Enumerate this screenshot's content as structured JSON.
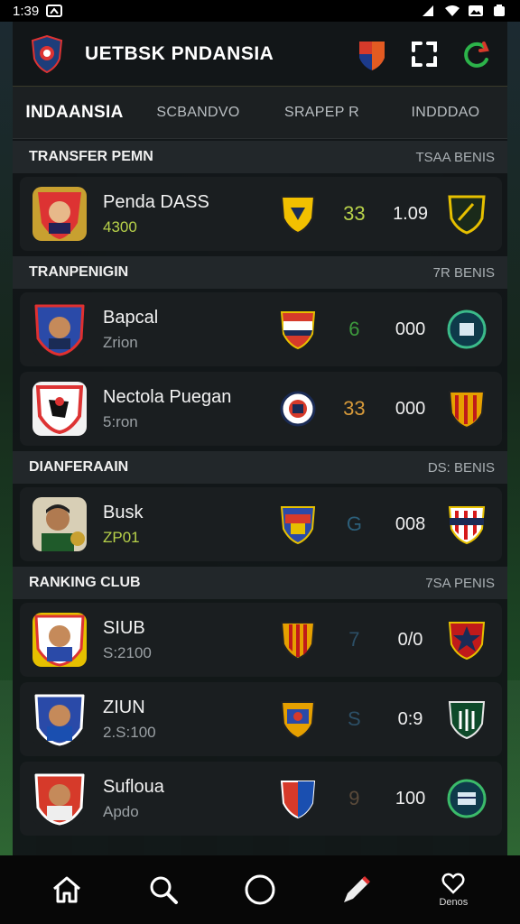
{
  "status_bar": {
    "time": "1:39"
  },
  "header": {
    "title": "UETBSK PNDANSIA"
  },
  "tabs": [
    {
      "label": "INDAANSIA",
      "active": true
    },
    {
      "label": "SCBANDVO",
      "active": false
    },
    {
      "label": "SRAPEP R",
      "active": false
    },
    {
      "label": "INDDDAO",
      "active": false
    }
  ],
  "sections": [
    {
      "title": "TRANSFER PEMN",
      "right": "TSAA BENIS",
      "rows": [
        {
          "name": "Penda DASS",
          "sub": "4300",
          "sub_color": "#b8d24a",
          "num": "33",
          "num_color": "#b8d24a",
          "value": "1.09"
        }
      ]
    },
    {
      "title": "TRANPENIGIN",
      "right": "7R BENIS",
      "rows": [
        {
          "name": "Bapcal",
          "sub": "Zrion",
          "sub_color": "#9aa0a4",
          "num": "6",
          "num_color": "#3d9a3d",
          "value": "000"
        },
        {
          "name": "Nectola Puegan",
          "sub": "5:ron",
          "sub_color": "#9aa0a4",
          "num": "33",
          "num_color": "#d79a3a",
          "value": "000"
        }
      ]
    },
    {
      "title": "DIANFERAAIN",
      "right": "DS: BENIS",
      "rows": [
        {
          "name": "Busk",
          "sub": "ZP01",
          "sub_color": "#b8d24a",
          "num": "G",
          "num_color": "#2c5f7a",
          "value": "008"
        }
      ]
    },
    {
      "title": "RANKING CLUB",
      "right": "7SA PENIS",
      "rows": [
        {
          "name": "SIUB",
          "sub": "S:2100",
          "sub_color": "#9aa0a4",
          "num": "7",
          "num_color": "#2c4f66",
          "value": "0/0"
        },
        {
          "name": "ZIUN",
          "sub": "2.S:100",
          "sub_color": "#9aa0a4",
          "num": "S",
          "num_color": "#2c4f66",
          "value": "0:9"
        },
        {
          "name": "Sufloua",
          "sub": "Apdo",
          "sub_color": "#9aa0a4",
          "num": "9",
          "num_color": "#5a4a3a",
          "value": "100"
        }
      ]
    }
  ],
  "bottom_nav": [
    {
      "icon": "home-icon"
    },
    {
      "icon": "search-icon"
    },
    {
      "icon": "circle-icon"
    },
    {
      "icon": "pen-icon"
    },
    {
      "icon": "heart-icon",
      "label": "Denos"
    }
  ]
}
